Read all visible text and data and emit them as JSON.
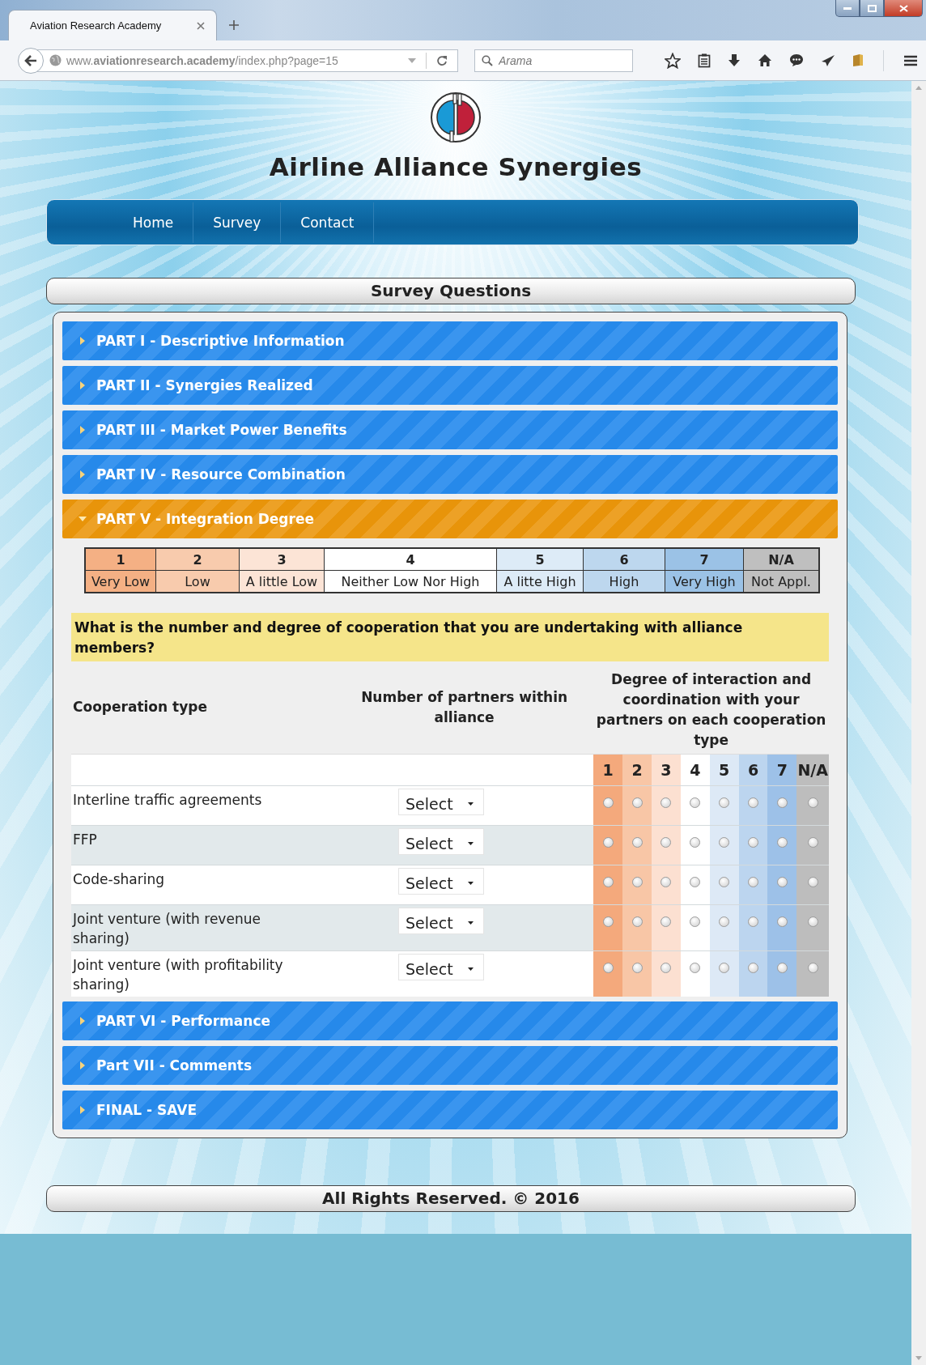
{
  "browser": {
    "tabs": [
      {
        "title": "Aviation Research Academy",
        "selected": true
      }
    ],
    "url": "www.**aviationresearch.academy**/index.php?page=15",
    "search": {
      "placeholder": "Arama"
    }
  },
  "site": {
    "title": "Airline Alliance Synergies",
    "nav": [
      "Home",
      "Survey",
      "Contact"
    ]
  },
  "section_title": "Survey Questions",
  "parts": [
    {
      "title": "PART I - Descriptive Information",
      "expanded": false
    },
    {
      "title": "PART II - Synergies Realized",
      "expanded": false
    },
    {
      "title": "PART III - Market Power Benefits",
      "expanded": false
    },
    {
      "title": "PART IV - Resource Combination",
      "expanded": false
    },
    {
      "title": "PART V - Integration Degree",
      "expanded": true,
      "scale": [
        {
          "number": "1",
          "label": "Very Low",
          "color": "#f4b084"
        },
        {
          "number": "2",
          "label": "Low",
          "color": "#f8cbad"
        },
        {
          "number": "3",
          "label": "A little Low",
          "color": "#fce4d6"
        },
        {
          "number": "4",
          "label": "Neither Low Nor High",
          "color": "#ffffff"
        },
        {
          "number": "5",
          "label": "A litte High",
          "color": "#ddebf7"
        },
        {
          "number": "6",
          "label": "High",
          "color": "#bdd7ee"
        },
        {
          "number": "7",
          "label": "Very High",
          "color": "#9bc2e6"
        },
        {
          "number": "N/A",
          "label": "Not Appl.",
          "color": "#bfbfbf"
        }
      ],
      "question": "What is the number and degree of cooperation that you are undertaking with alliance members?",
      "table": {
        "columns": [
          "Cooperation type",
          "Number of partners within alliance",
          "Degree of interaction and coordination with your partners on each cooperation type"
        ],
        "rating_columns": [
          {
            "label": "1",
            "color": "#f4a97c"
          },
          {
            "label": "2",
            "color": "#f8c6a6"
          },
          {
            "label": "3",
            "color": "#fce0d1"
          },
          {
            "label": "4",
            "color": "#ffffff"
          },
          {
            "label": "5",
            "color": "#dde9f6"
          },
          {
            "label": "6",
            "color": "#bcd5ef"
          },
          {
            "label": "7",
            "color": "#9dc1e8"
          },
          {
            "label": "N/A",
            "color": "#bdbdbd"
          }
        ],
        "rows": [
          {
            "cooperation_type": "Interline traffic agreements",
            "partners": "Select",
            "ratings": [
              {
                "selected": false
              },
              {
                "selected": false
              },
              {
                "selected": false
              },
              {
                "selected": false
              },
              {
                "selected": false
              },
              {
                "selected": false
              },
              {
                "selected": false
              },
              {
                "selected": false
              }
            ]
          },
          {
            "cooperation_type": "FFP",
            "partners": "Select",
            "ratings": [
              {
                "selected": false
              },
              {
                "selected": false
              },
              {
                "selected": false
              },
              {
                "selected": false
              },
              {
                "selected": false
              },
              {
                "selected": false
              },
              {
                "selected": false
              },
              {
                "selected": false
              }
            ]
          },
          {
            "cooperation_type": "Code-sharing",
            "partners": "Select",
            "ratings": [
              {
                "selected": false
              },
              {
                "selected": false
              },
              {
                "selected": false
              },
              {
                "selected": false
              },
              {
                "selected": false
              },
              {
                "selected": false
              },
              {
                "selected": false
              },
              {
                "selected": false
              }
            ]
          },
          {
            "cooperation_type": "Joint venture (with revenue sharing)",
            "partners": "Select",
            "ratings": [
              {
                "selected": false
              },
              {
                "selected": false
              },
              {
                "selected": false
              },
              {
                "selected": false
              },
              {
                "selected": false
              },
              {
                "selected": false
              },
              {
                "selected": false
              },
              {
                "selected": false
              }
            ]
          },
          {
            "cooperation_type": "Joint venture (with profitability sharing)",
            "partners": "Select",
            "ratings": [
              {
                "selected": false
              },
              {
                "selected": false
              },
              {
                "selected": false
              },
              {
                "selected": false
              },
              {
                "selected": false
              },
              {
                "selected": false
              },
              {
                "selected": false
              },
              {
                "selected": false
              }
            ]
          }
        ]
      }
    },
    {
      "title": "PART VI - Performance",
      "expanded": false
    },
    {
      "title": "Part VII - Comments",
      "expanded": false
    },
    {
      "title": "FINAL - SAVE",
      "expanded": false
    }
  ],
  "footer": "All Rights Reserved. © 2016"
}
